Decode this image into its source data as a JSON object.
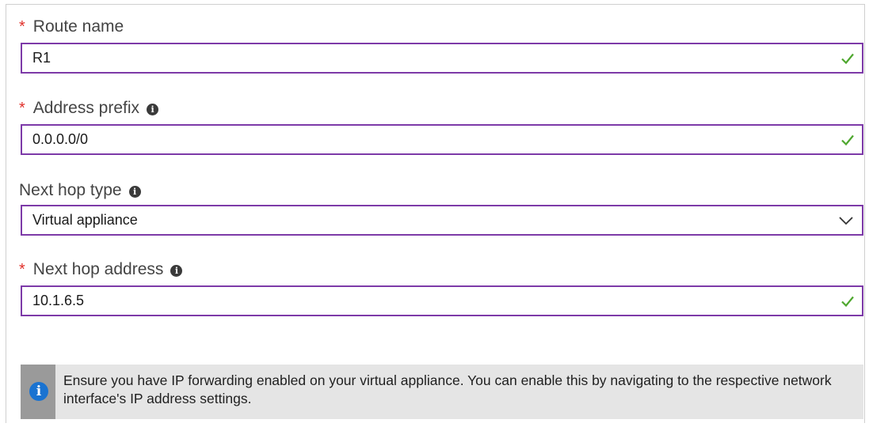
{
  "form": {
    "route_name": {
      "label": "Route name",
      "required_mark": "*",
      "value": "R1"
    },
    "address_prefix": {
      "label": "Address prefix",
      "required_mark": "*",
      "value": "0.0.0.0/0"
    },
    "next_hop_type": {
      "label": "Next hop type",
      "value": "Virtual appliance"
    },
    "next_hop_address": {
      "label": "Next hop address",
      "required_mark": "*",
      "value": "10.1.6.5"
    }
  },
  "info_banner": {
    "text": "Ensure you have IP forwarding enabled on your virtual appliance. You can enable this by navigating to the respective network interface's IP address settings."
  },
  "icons": {
    "valid": "checkmark-icon",
    "info": "info-icon",
    "dropdown": "chevron-down-icon"
  },
  "colors": {
    "field_border": "#7d3aa8",
    "required": "#e0302a",
    "valid_check": "#4ea72e",
    "info_blue": "#1a73d1",
    "banner_bg": "#e5e5e5",
    "banner_strip": "#9a9a9a"
  }
}
